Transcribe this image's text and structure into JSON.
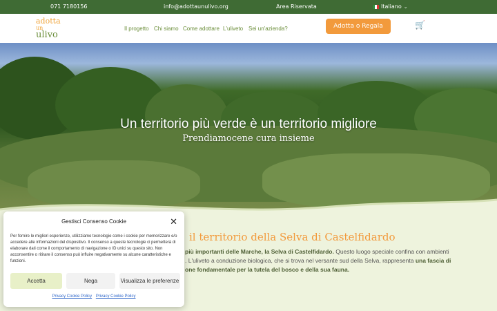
{
  "topbar": {
    "phone": "071 7180156",
    "email": "info@adottaunulivo.org",
    "reserved_area": "Area Riservata",
    "language": "Italiano"
  },
  "header": {
    "logo_line1": "adotta",
    "logo_line2": "un",
    "logo_line3": "ulivo",
    "nav": [
      "Il progetto",
      "Chi siamo",
      "Come adottare",
      "L'uliveto",
      "Sei un'azienda?"
    ],
    "cta": "Adotta o Regala",
    "cart_icon": "cart-icon"
  },
  "hero": {
    "title": "Un territorio più verde è un territorio migliore",
    "subtitle": "Prendiamocene cura insieme"
  },
  "section": {
    "title": "il territorio della Selva di Castelfidardo",
    "text_1a": "più importanti delle Marche, la Selva di Castelfidardo.",
    "text_1b": " Questo luogo speciale confina con ambienti",
    "text_2a": ". L'uliveto a conduzione biologica, che si trova nel versante sud della Selva, rappresenta ",
    "text_2b": "una fascia di",
    "text_3": "one fondamentale per la tutela del bosco e della sua fauna."
  },
  "cookie": {
    "title": "Gestisci Consenso Cookie",
    "text": "Per fornire le migliori esperienze, utilizziamo tecnologie come i cookie per memorizzare e/o accedere alle informazioni del dispositivo. Il consenso a queste tecnologie ci permetterà di elaborare dati come il comportamento di navigazione o ID unici su questo sito. Non acconsentire o ritirare il consenso può influire negativamente su alcune caratteristiche e funzioni.",
    "accept": "Accetta",
    "deny": "Nega",
    "preferences": "Visualizza le preferenze",
    "link1": "Privacy Cookie Policy",
    "link2": "Privacy Cookie Policy"
  },
  "colors": {
    "topbar": "#3f6b34",
    "accent_orange": "#f29a3c",
    "nav_green": "#6b8e3a",
    "accept_button": "#e8f0c8"
  }
}
